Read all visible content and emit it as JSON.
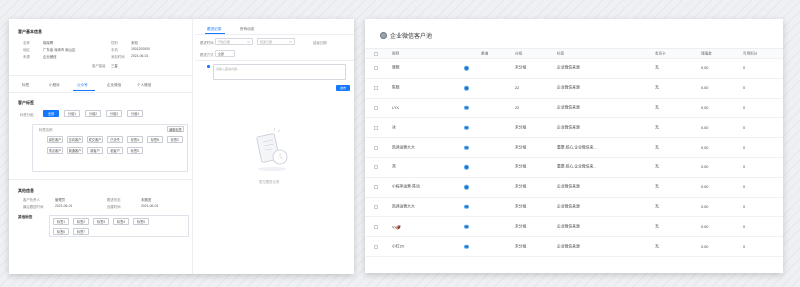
{
  "left": {
    "customer_info_title": "客户基本信息",
    "info": [
      {
        "label": "名称",
        "value": "晓晓啊"
      },
      {
        "label": "性别",
        "value": "未知"
      },
      {
        "label": "地区",
        "value": "广东省 深圳市 南山区"
      },
      {
        "label": "手机",
        "value": "1501200000"
      },
      {
        "label": "来源",
        "value": "企业微信"
      },
      {
        "label": "添加时间",
        "value": "2021-06-01"
      },
      {
        "label": "客户星级",
        "value": "三星"
      }
    ],
    "tabs": [
      "标签",
      "小程序",
      "公众号",
      "企业微信",
      "个人微信"
    ],
    "customer_tag_title": "客户标签",
    "tag_group_label": "标签分组",
    "tag_group_chips": [
      "全部",
      "分组1",
      "分组2",
      "分组3",
      "分组4"
    ],
    "tag_box_label": "标签名称",
    "tag_box_action": "编辑标签",
    "tags_row1": [
      "潜在客户",
      "意向客户",
      "成交客户",
      "已流失",
      "标签A",
      "标签B",
      "标签C"
    ],
    "tags_row2": [
      "重点客户",
      "普通客户",
      "新客户",
      "老客户",
      "标签D"
    ],
    "other_info_title": "其他信息",
    "other_info": [
      {
        "label": "客户负责人",
        "value": "管理员"
      },
      {
        "label": "跟进状态",
        "value": "未跟进"
      },
      {
        "label": "最后跟进时间",
        "value": "2021-06-01"
      },
      {
        "label": "创建时间",
        "value": "2021-06-01"
      }
    ],
    "other_tag_title": "其他标签",
    "other_tags_row1": [
      "标签1",
      "标签2",
      "标签3",
      "标签4",
      "标签5"
    ],
    "other_tags_row2": [
      "标签6",
      "标签7"
    ]
  },
  "middle": {
    "tabs": [
      "跟进记录",
      "所有动态"
    ],
    "date_label": "跟进时间",
    "date_start": "开始日期",
    "date_end": "结束日期",
    "date_end2": "结束日期",
    "type_label": "跟进方式",
    "type_value": "全部",
    "textarea_placeholder": "请输入跟进内容...",
    "submit": "发布",
    "empty_text": "暂无跟进记录"
  },
  "right": {
    "title": "企业微信客户池",
    "columns": [
      "昵称",
      "渠道",
      "分组",
      "标签",
      "会员卡",
      "储值金",
      "可用积分"
    ],
    "rows": [
      {
        "name": "晓晓",
        "group": "未分组",
        "tag": "企业微信来源",
        "card": "无",
        "balance": "0.00",
        "points": "0"
      },
      {
        "name": "陈晓",
        "group": "22",
        "tag": "企业微信来源",
        "card": "无",
        "balance": "0.00",
        "points": "0"
      },
      {
        "name": "LYX",
        "group": "22",
        "tag": "企业微信来源",
        "card": "无",
        "balance": "0.00",
        "points": "0"
      },
      {
        "name": "冰",
        "group": "未分组",
        "tag": "企业微信来源",
        "card": "无",
        "balance": "0.00",
        "points": "0"
      },
      {
        "name": "凯迪运营大大",
        "group": "未分组",
        "tag": "重要,核心,企业微信来...",
        "card": "无",
        "balance": "0.00",
        "points": "0"
      },
      {
        "name": "🈷",
        "group": "未分组",
        "tag": "重要,核心,企业微信来...",
        "card": "无",
        "balance": "0.00",
        "points": "0"
      },
      {
        "name": "小程序运营-陈动",
        "group": "未分组",
        "tag": "企业微信来源",
        "card": "无",
        "balance": "0.00",
        "points": "0"
      },
      {
        "name": "凯迪运营大大",
        "group": "未分组",
        "tag": "企业微信来源",
        "card": "无",
        "balance": "0.00",
        "points": "0"
      },
      {
        "name": "Vx🏈",
        "group": "未分组",
        "tag": "企业微信来源",
        "card": "无",
        "balance": "0.00",
        "points": "0"
      },
      {
        "name": "小钉ZX",
        "group": "未分组",
        "tag": "企业微信来源",
        "card": "无",
        "balance": "0.00",
        "points": "0"
      }
    ]
  }
}
